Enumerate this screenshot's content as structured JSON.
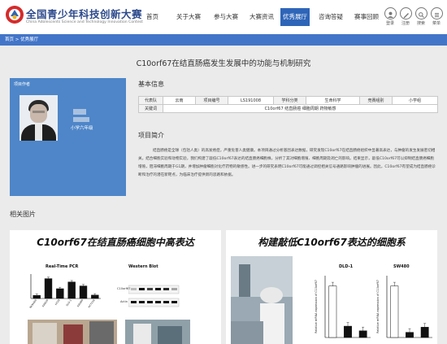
{
  "header": {
    "brand_title": "全国青少年科技创新大赛",
    "brand_subtitle": "China Adolescents Science and Technology Innovation Contest",
    "nav": [
      "首页",
      "关于大赛",
      "参与大赛",
      "大赛资讯",
      "优秀展厅",
      "咨询答疑",
      "赛事回顾"
    ],
    "active_nav_index": 4,
    "tools": [
      "登录",
      "注册",
      "搜索",
      "菜单"
    ]
  },
  "breadcrumb": "首页 > 优秀展厅",
  "page_title": "C10orf67在结直肠癌发生发展中的功能与机制研究",
  "profile": {
    "label": "项目作者",
    "class_info": "小学六年级"
  },
  "basic_info": {
    "heading": "基本信息",
    "rows": [
      [
        "代表队",
        "云南",
        "项目编号",
        "LS191008",
        "学科分类",
        "生命科学",
        "竞赛组别",
        "小学组"
      ],
      [
        "关键词",
        "C10orf67 结直肠癌 细胞周期 药物敏感"
      ]
    ]
  },
  "summary": {
    "heading": "项目简介",
    "text": "结直肠癌是全球（包括人类）的高发癌症，严重危害人类健康。本项目通过分析基因表达数据，研究发现C10orf67在结直肠癌组织中显著高表达，与肿瘤的发生发展密切相关。结合细胞实验和动物实验，我们构建了敲低C10orf67表达的结直肠癌细胞株，分析了其对细胞增殖、细胞周期及凋亡的影响。结果显示，敲低C10orf67可以抑制结直肠癌细胞增殖，阻滞细胞周期于G1期，并增加肿瘤细胞对化疗药物的敏感性。进一步的研究表明C10orf67可能通过调控相关信号通路影响肿瘤的进展。因此，C10orf67有望成为结直肠癌诊断和治疗的潜在新靶点，为临床治疗提供新的思路和依据。"
  },
  "gallery": {
    "heading": "相关图片",
    "images": [
      {
        "title": "C10orf67在结直肠癌细胞中高表达",
        "pcr_label": "Real-Time PCR",
        "wb_label": "Western Blot",
        "wb_target": "C10orf67",
        "wb_control": "Actin"
      },
      {
        "title": "构建敲低C10orf67表达的细胞系",
        "cell_lines": [
          "DLD-1",
          "SW480"
        ],
        "ylabel": "Relative mRNA expression of C10orf67"
      }
    ]
  },
  "chart_data": [
    {
      "type": "bar",
      "categories": [
        "NCM460",
        "SW620",
        "HT29",
        "DLD-1",
        "SW480",
        "HCT116"
      ],
      "values": [
        1.0,
        6.5,
        3.2,
        5.4,
        4.1,
        1.1
      ],
      "title": "Real-Time PCR",
      "xlabel": "",
      "ylabel": "",
      "ylim": [
        0,
        8
      ]
    },
    {
      "type": "bar",
      "categories": [
        "NC",
        "sh1",
        "sh2"
      ],
      "values": [
        1.0,
        0.22,
        0.13
      ],
      "title": "DLD-1",
      "ylabel": "Relative mRNA expression of C10orf67",
      "ylim": [
        0,
        1.2
      ]
    },
    {
      "type": "bar",
      "categories": [
        "NC",
        "sh1",
        "sh2"
      ],
      "values": [
        1.0,
        0.1,
        0.2
      ],
      "title": "SW480",
      "ylabel": "Relative mRNA expression of C10orf67",
      "ylim": [
        0,
        1.2
      ]
    }
  ]
}
